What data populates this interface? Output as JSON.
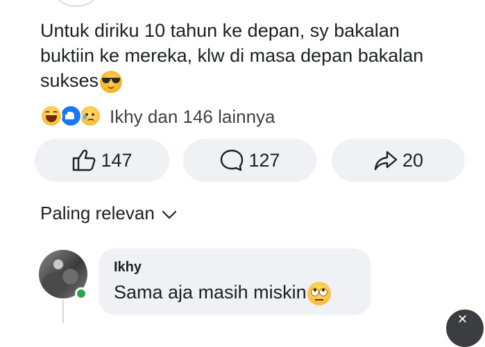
{
  "post": {
    "text": "Untuk diriku 10 tahun ke depan, sy bakalan buktiin ke mereka, klw di masa depan bakalan sukses",
    "text_emoji": "smiling-face-with-sunglasses-icon"
  },
  "reactions": {
    "icons": [
      "haha-reaction-icon",
      "like-reaction-icon",
      "sad-reaction-icon"
    ],
    "summary": "Ikhy dan 146 lainnya"
  },
  "actions": {
    "like_count": "147",
    "comment_count": "127",
    "share_count": "20"
  },
  "sort": {
    "label": "Paling relevan"
  },
  "comment": {
    "author": "Ikhy",
    "text": "Sama aja masih miskin",
    "text_emoji": "face-with-rolling-eyes-icon",
    "online": true
  },
  "overlay": {
    "close_glyph": "✕"
  },
  "colors": {
    "like_blue": "#1877f2",
    "online_green": "#31a24c",
    "pill_bg": "#f0f1f5"
  }
}
